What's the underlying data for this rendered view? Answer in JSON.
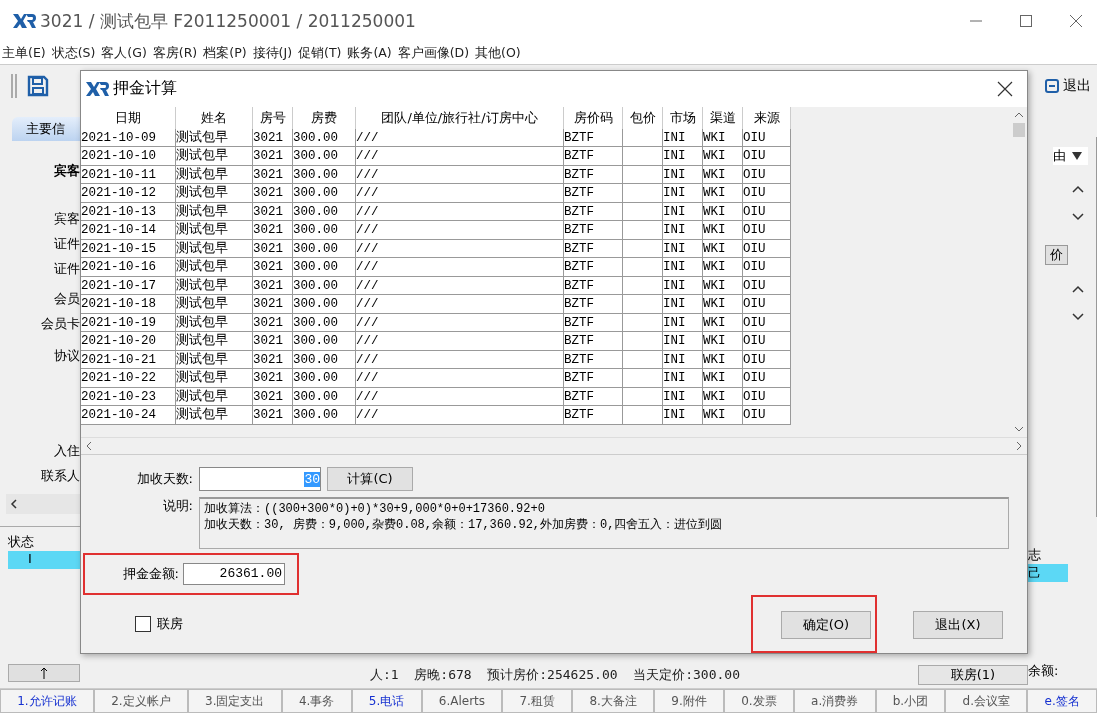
{
  "window": {
    "title": "3021 / 测试包早 F2011250001 / 2011250001"
  },
  "menu": [
    "主单(E)",
    "状态(S)",
    "客人(G)",
    "客房(R)",
    "档案(P)",
    "接待(J)",
    "促销(T)",
    "账务(A)",
    "客户画像(D)",
    "其他(O)"
  ],
  "toolbar": {
    "exit_button": "退出"
  },
  "left_panel": {
    "tab": "主要信",
    "labels": [
      "宾客",
      "宾客",
      "证件",
      "证件",
      "会员",
      "会员卡",
      "协议",
      "入住",
      "联系人"
    ],
    "status_header": "状态",
    "status_value": "I"
  },
  "right_panel": {
    "dropdown_text": "由",
    "price_button": "价",
    "flag_header": "志",
    "flag_value": "己",
    "balance_label": "余额:"
  },
  "status_line": "人:1  房晚:678  预计房价:254625.00  当天定价:300.00",
  "link_room_button": "联房(1)",
  "dialog": {
    "title": "押金计算",
    "columns": [
      "日期",
      "姓名",
      "房号",
      "房费",
      "团队/单位/旅行社/订房中心",
      "房价码",
      "包价",
      "市场",
      "渠道",
      "来源"
    ],
    "rows": [
      [
        "2021-10-09",
        "测试包早",
        "3021",
        "300.00",
        "///",
        "BZTF",
        "",
        "INI",
        "WKI",
        "OIU"
      ],
      [
        "2021-10-10",
        "测试包早",
        "3021",
        "300.00",
        "///",
        "BZTF",
        "",
        "INI",
        "WKI",
        "OIU"
      ],
      [
        "2021-10-11",
        "测试包早",
        "3021",
        "300.00",
        "///",
        "BZTF",
        "",
        "INI",
        "WKI",
        "OIU"
      ],
      [
        "2021-10-12",
        "测试包早",
        "3021",
        "300.00",
        "///",
        "BZTF",
        "",
        "INI",
        "WKI",
        "OIU"
      ],
      [
        "2021-10-13",
        "测试包早",
        "3021",
        "300.00",
        "///",
        "BZTF",
        "",
        "INI",
        "WKI",
        "OIU"
      ],
      [
        "2021-10-14",
        "测试包早",
        "3021",
        "300.00",
        "///",
        "BZTF",
        "",
        "INI",
        "WKI",
        "OIU"
      ],
      [
        "2021-10-15",
        "测试包早",
        "3021",
        "300.00",
        "///",
        "BZTF",
        "",
        "INI",
        "WKI",
        "OIU"
      ],
      [
        "2021-10-16",
        "测试包早",
        "3021",
        "300.00",
        "///",
        "BZTF",
        "",
        "INI",
        "WKI",
        "OIU"
      ],
      [
        "2021-10-17",
        "测试包早",
        "3021",
        "300.00",
        "///",
        "BZTF",
        "",
        "INI",
        "WKI",
        "OIU"
      ],
      [
        "2021-10-18",
        "测试包早",
        "3021",
        "300.00",
        "///",
        "BZTF",
        "",
        "INI",
        "WKI",
        "OIU"
      ],
      [
        "2021-10-19",
        "测试包早",
        "3021",
        "300.00",
        "///",
        "BZTF",
        "",
        "INI",
        "WKI",
        "OIU"
      ],
      [
        "2021-10-20",
        "测试包早",
        "3021",
        "300.00",
        "///",
        "BZTF",
        "",
        "INI",
        "WKI",
        "OIU"
      ],
      [
        "2021-10-21",
        "测试包早",
        "3021",
        "300.00",
        "///",
        "BZTF",
        "",
        "INI",
        "WKI",
        "OIU"
      ],
      [
        "2021-10-22",
        "测试包早",
        "3021",
        "300.00",
        "///",
        "BZTF",
        "",
        "INI",
        "WKI",
        "OIU"
      ],
      [
        "2021-10-23",
        "测试包早",
        "3021",
        "300.00",
        "///",
        "BZTF",
        "",
        "INI",
        "WKI",
        "OIU"
      ],
      [
        "2021-10-24",
        "测试包早",
        "3021",
        "300.00",
        "///",
        "BZTF",
        "",
        "INI",
        "WKI",
        "OIU"
      ]
    ],
    "extra_days": {
      "label": "加收天数:",
      "value": "30",
      "button": "计算(C)"
    },
    "description": {
      "label": "说明:",
      "lines": [
        "加收算法：((300+300*0)+0)*30+9,000*0+0+17360.92+0",
        "加收天数：30, 房费：9,000,杂费0.08,余额：17,360.92,外加房费：0,四舍五入：进位到圆"
      ]
    },
    "deposit": {
      "label": "押金金额:",
      "value": "26361.00",
      "marked": true
    },
    "link_room": {
      "label": "联房",
      "checked": false
    },
    "buttons": [
      {
        "label": "确定(O)",
        "marked": true
      },
      {
        "label": "退出(X)",
        "marked": false
      }
    ]
  },
  "bottom_tabs": [
    {
      "label": "1.允许记账",
      "highlight": true
    },
    {
      "label": "2.定义帐户",
      "highlight": false
    },
    {
      "label": "3.固定支出",
      "highlight": false
    },
    {
      "label": "4.事务",
      "highlight": false
    },
    {
      "label": "5.电话",
      "highlight": true
    },
    {
      "label": "6.Alerts",
      "highlight": false
    },
    {
      "label": "7.租赁",
      "highlight": false
    },
    {
      "label": "8.大备注",
      "highlight": false
    },
    {
      "label": "9.附件",
      "highlight": false
    },
    {
      "label": "0.发票",
      "highlight": false
    },
    {
      "label": "a.消费券",
      "highlight": false
    },
    {
      "label": "b.小团",
      "highlight": false
    },
    {
      "label": "d.会议室",
      "highlight": false
    },
    {
      "label": "e.签名",
      "highlight": true
    }
  ]
}
